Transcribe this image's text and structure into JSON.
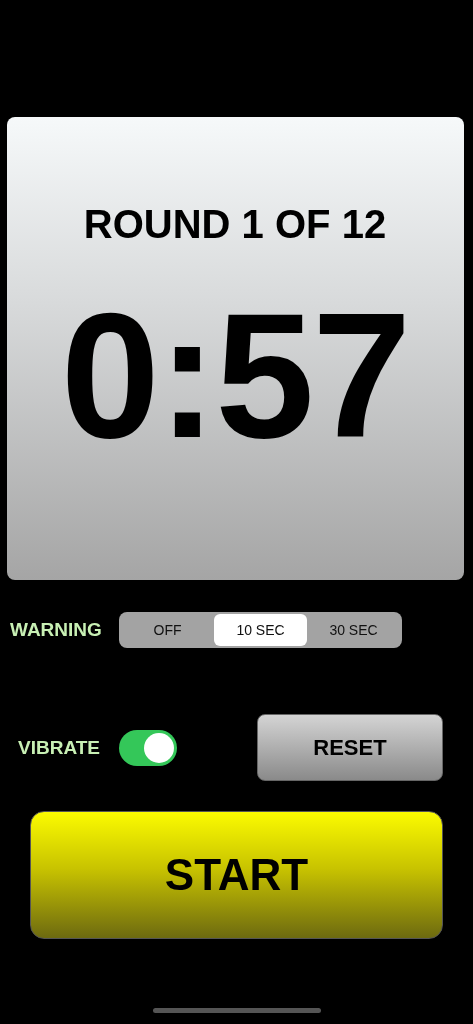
{
  "timer_card": {
    "round_label": "ROUND 1 OF 12",
    "time": "0:57"
  },
  "warning": {
    "label": "WARNING",
    "options": [
      {
        "label": "OFF",
        "selected": false
      },
      {
        "label": "10 SEC",
        "selected": true
      },
      {
        "label": "30 SEC",
        "selected": false
      }
    ]
  },
  "vibrate": {
    "label": "VIBRATE",
    "on": true
  },
  "reset_button": "RESET",
  "start_button": "START"
}
